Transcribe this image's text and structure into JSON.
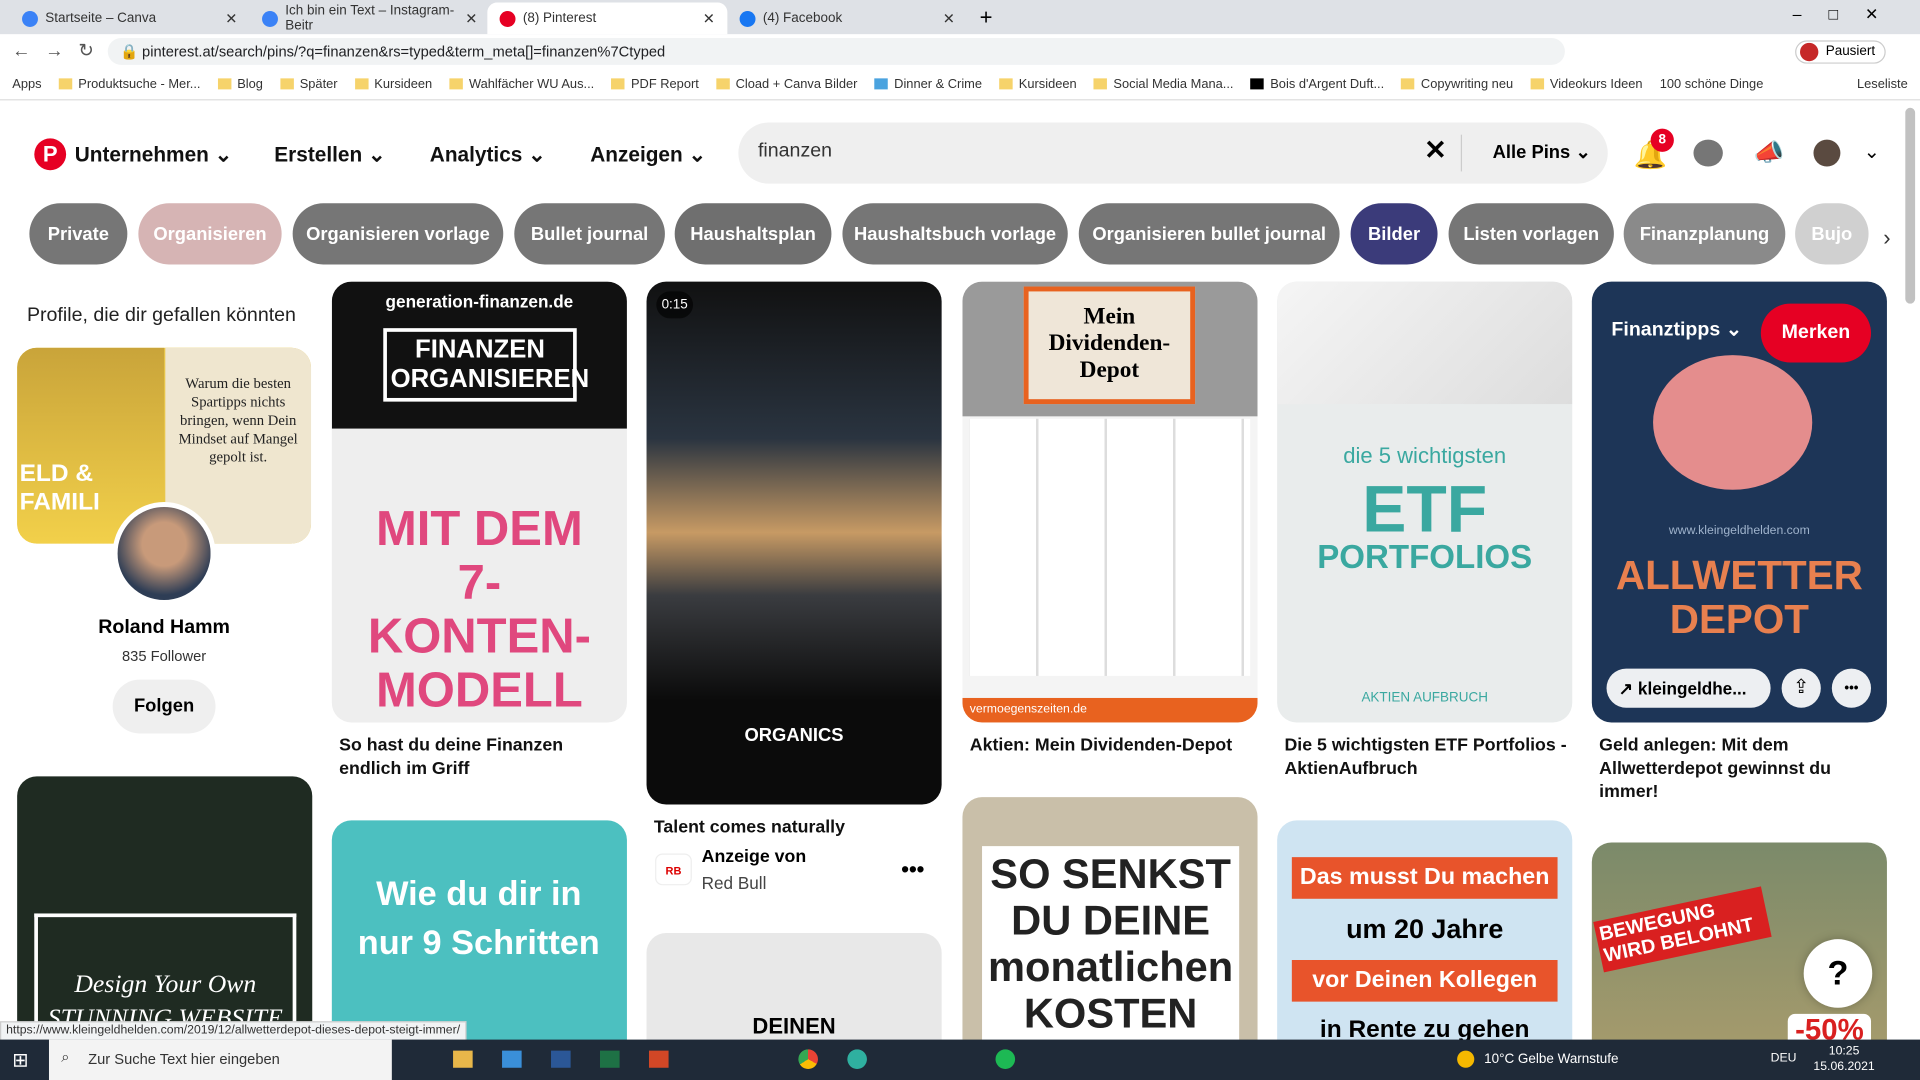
{
  "browser": {
    "tabs": [
      {
        "title": "Startseite – Canva",
        "color": "#3b82f6"
      },
      {
        "title": "Ich bin ein Text – Instagram-Beitr",
        "color": "#3b82f6"
      },
      {
        "title": "(8) Pinterest",
        "color": "#e60023"
      },
      {
        "title": "(4) Facebook",
        "color": "#1877f2"
      }
    ],
    "url": "pinterest.at/search/pins/?q=finanzen&rs=typed&term_meta[]=finanzen%7Ctyped",
    "profile_label": "Pausiert",
    "bookmarks": [
      "Apps",
      "Produktsuche - Mer...",
      "Blog",
      "Später",
      "Kursideen",
      "Wahlfächer WU Aus...",
      "PDF Report",
      "Cload + Canva Bilder",
      "Dinner & Crime",
      "Kursideen",
      "Social Media Mana...",
      "Bois d'Argent Duft...",
      "Copywriting neu",
      "Videokurs Ideen",
      "100 schöne Dinge"
    ],
    "reading_list": "Leseliste"
  },
  "nav": {
    "business": "Unternehmen",
    "create": "Erstellen",
    "analytics": "Analytics",
    "ads": "Anzeigen",
    "search_value": "finanzen",
    "filter": "Alle Pins",
    "notifications": "8"
  },
  "chips": [
    {
      "label": "Private",
      "color": "#767676"
    },
    {
      "label": "Organisieren",
      "color": "#d6b4b4"
    },
    {
      "label": "Organisieren vorlage",
      "color": "#767676"
    },
    {
      "label": "Bullet journal",
      "color": "#767676"
    },
    {
      "label": "Haushaltsplan",
      "color": "#6f6f6f"
    },
    {
      "label": "Haushaltsbuch vorlage",
      "color": "#767676"
    },
    {
      "label": "Organisieren bullet journal",
      "color": "#767676"
    },
    {
      "label": "Bilder",
      "color": "#3b3b7a"
    },
    {
      "label": "Listen vorlagen",
      "color": "#767676"
    },
    {
      "label": "Finanzplanung",
      "color": "#8a8a8a"
    },
    {
      "label": "Bujo",
      "color": "#d0d0d0"
    }
  ],
  "profile_card": {
    "heading": "Profile, die dir gefallen könnten",
    "name": "Roland Hamm",
    "followers": "835 Follower",
    "follow": "Folgen",
    "img_left": "ELD & FAMILI",
    "img_right": "Warum die besten Spartipps nichts bringen, wenn Dein Mindset auf Mangel gepolt ist."
  },
  "pins": {
    "p1": {
      "site": "generation-finanzen.de",
      "box": "FINANZEN ORGANISIEREN",
      "big": "MIT DEM 7-KONTEN-MODELL",
      "title": "So hast du deine Finanzen endlich im Griff"
    },
    "p2": {
      "duration": "0:15",
      "brand": "ORGANICS",
      "title": "Talent comes naturally",
      "ad_label": "Anzeige von",
      "advertiser": "Red Bull"
    },
    "p3": {
      "img": "Mein Dividenden-Depot",
      "site": "vermoegenszeiten.de",
      "title": "Aktien: Mein Dividenden-Depot"
    },
    "p4": {
      "small": "die 5 wichtigsten",
      "big1": "ETF",
      "big2": "PORTFOLIOS",
      "brand": "AKTIEN AUFBRUCH",
      "title": "Die 5 wichtigsten ETF Portfolios - AktienAufbruch"
    },
    "p5": {
      "board": "Finanztipps",
      "save": "Merken",
      "site": "www.kleingeldhelden.com",
      "big": "ALLWETTER DEPOT",
      "link": "kleingeldhe...",
      "title": "Geld anlegen: Mit dem Allwetterdepot gewinnst du immer!"
    },
    "p6": {
      "text": "Design Your Own STUNNING WEBSITE"
    },
    "p7": {
      "text": "Wie du dir in nur 9 Schritten"
    },
    "p8": {
      "text": "DEINEN"
    },
    "p9": {
      "text": "SO SENKST DU DEINE monatlichen KOSTEN MASSIV"
    },
    "p10": {
      "l1": "Das musst Du machen",
      "l2": "um 20 Jahre",
      "l3": "vor Deinen Kollegen",
      "l4": "in Rente zu gehen"
    },
    "p11": {
      "text": "BEWEGUNG WIRD BELOHNT",
      "badge": "-50%"
    }
  },
  "help": "?",
  "status_url": "https://www.kleingeldhelden.com/2019/12/allwetterdepot-dieses-depot-steigt-immer/",
  "taskbar": {
    "search": "Zur Suche Text hier eingeben",
    "weather": "10°C  Gelbe Warnstufe",
    "lang": "DEU",
    "time": "10:25",
    "date": "15.06.2021"
  }
}
